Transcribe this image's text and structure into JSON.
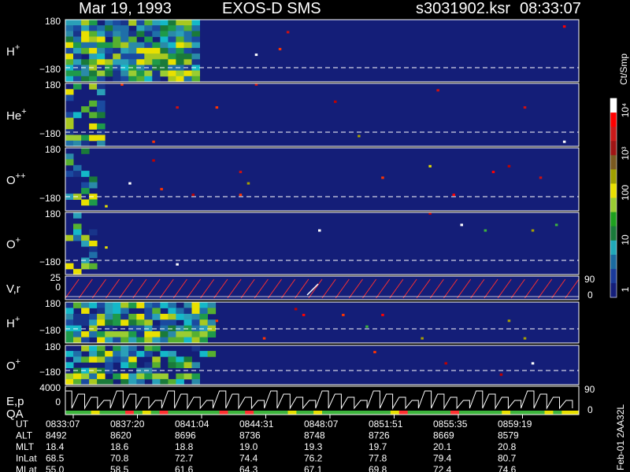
{
  "header": {
    "date": "Mar 19, 1993",
    "instrument": "EXOS-D SMS",
    "file": "s3031902.ksr",
    "time": "08:33:07"
  },
  "colorbar": {
    "unit": "Ct/Smp",
    "ticks": [
      "10⁴",
      "10³",
      "100",
      "10",
      "1"
    ],
    "levels": [
      "#ffffff",
      "#ff0000",
      "#cc1a1a",
      "#a01414",
      "#7a5a20",
      "#a0a000",
      "#e8e000",
      "#9acd32",
      "#1ea01e",
      "#1a7a3a",
      "#20a8b8",
      "#1a6aa0",
      "#1a3a9a",
      "#141e7a"
    ]
  },
  "footer": {
    "rows": [
      {
        "label": "UT",
        "values": [
          "0833:07",
          "0837:20",
          "0841:04",
          "0844:31",
          "0848:07",
          "0851:51",
          "0855:35",
          "0859:19"
        ]
      },
      {
        "label": "ALT",
        "values": [
          "8492",
          "8620",
          "8696",
          "8736",
          "8748",
          "8726",
          "8669",
          "8579"
        ]
      },
      {
        "label": "MLT",
        "values": [
          "18.4",
          "18.6",
          "18.8",
          "19.0",
          "19.3",
          "19.7",
          "20.1",
          "20.8"
        ]
      },
      {
        "label": "InLat",
        "values": [
          "68.5",
          "70.8",
          "72.7",
          "74.4",
          "76.2",
          "77.8",
          "79.4",
          "80.7"
        ]
      },
      {
        "label": "MLat",
        "values": [
          "55.0",
          "58.5",
          "61.6",
          "64.3",
          "67.1",
          "69.8",
          "72.4",
          "74.6"
        ]
      }
    ],
    "side_label": "Feb-01 2AA32L"
  },
  "chart_data": {
    "type": "heatmap",
    "x_ticks": [
      "0833:07",
      "0837:20",
      "0841:04",
      "0844:31",
      "0848:07",
      "0851:51",
      "0855:35",
      "0859:19"
    ],
    "panels": [
      {
        "id": "h-plus-1",
        "label": "H",
        "sup": "+",
        "y_top": "180",
        "y_bottom": "−180",
        "kind": "spectrogram",
        "dense_until": 0.26,
        "density": 0.95
      },
      {
        "id": "he-plus",
        "label": "He",
        "sup": "+",
        "y_top": "180",
        "y_bottom": "−180",
        "kind": "spectrogram",
        "dense_until": 0.07,
        "density": 0.4
      },
      {
        "id": "o-plus-plus",
        "label": "O",
        "sup": "++",
        "y_top": "180",
        "y_bottom": "−180",
        "kind": "spectrogram",
        "dense_until": 0.06,
        "density": 0.35
      },
      {
        "id": "o-plus-1",
        "label": "O",
        "sup": "+",
        "y_top": "180",
        "y_bottom": "−180",
        "kind": "spectrogram",
        "dense_until": 0.06,
        "density": 0.35
      },
      {
        "id": "v-r",
        "label": "V,r",
        "sup": "",
        "y_top": "25",
        "y_bottom": "0",
        "right_top": "90",
        "right_bottom": "0",
        "kind": "line"
      },
      {
        "id": "h-plus-2",
        "label": "H",
        "sup": "+",
        "y_top": "180",
        "y_bottom": "−180",
        "kind": "spectrogram",
        "dense_until": 0.29,
        "density": 0.9
      },
      {
        "id": "o-plus-2",
        "label": "O",
        "sup": "+",
        "y_top": "180",
        "y_bottom": "−180",
        "kind": "spectrogram",
        "dense_until": 0.29,
        "density": 0.6
      },
      {
        "id": "e-p-qa",
        "label": "E,p",
        "label2": "QA",
        "sup": "",
        "y_top": "4000",
        "y_bottom": "0",
        "right_top": "90",
        "right_bottom": "0",
        "kind": "steps"
      }
    ]
  }
}
